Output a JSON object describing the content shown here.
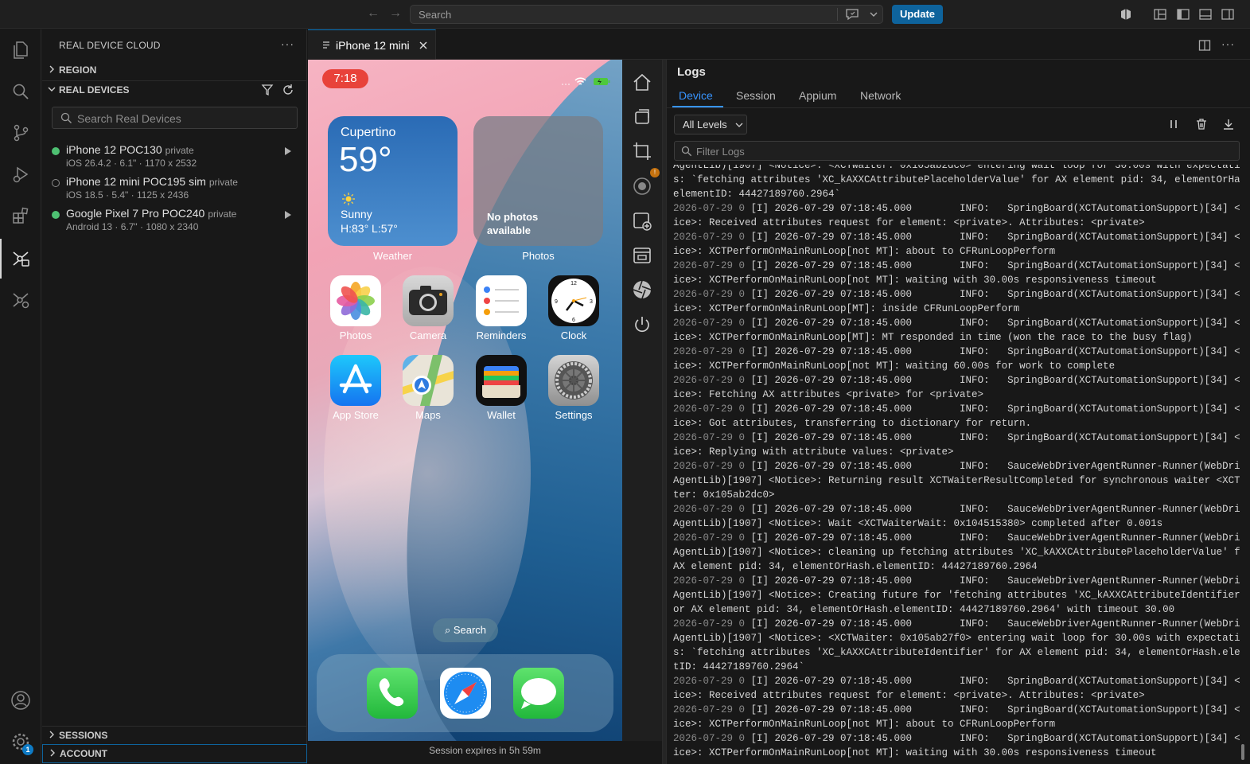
{
  "titlebar": {
    "search_placeholder": "Search",
    "update_label": "Update"
  },
  "sidebar": {
    "title": "REAL DEVICE CLOUD",
    "more": "···",
    "region_label": "REGION",
    "devices_label": "REAL DEVICES",
    "search_placeholder": "Search Real Devices",
    "devices": [
      {
        "name": "iPhone 12 POC130",
        "tag": "private",
        "spec": "iOS 26.4.2 · 6.1\" · 1170 x 2532",
        "status": "online"
      },
      {
        "name": "iPhone 12 mini POC195 sim",
        "tag": "private",
        "spec": "iOS 18.5 · 5.4\" · 1125 x 2436",
        "status": "offline"
      },
      {
        "name": "Google Pixel 7 Pro POC240",
        "tag": "private",
        "spec": "Android 13 · 6.7\" · 1080 x 2340",
        "status": "online"
      }
    ],
    "sessions_label": "SESSIONS",
    "account_label": "ACCOUNT",
    "settings_badge": "1"
  },
  "editor": {
    "tab_label": "iPhone 12 mini",
    "more": "···"
  },
  "phone": {
    "time": "7:18",
    "weather": {
      "city": "Cupertino",
      "temp": "59°",
      "condition": "Sunny",
      "hilo": "H:83° L:57°",
      "label": "Weather"
    },
    "photos_widget": {
      "text": "No photos available",
      "label": "Photos"
    },
    "apps": [
      "Photos",
      "Camera",
      "Reminders",
      "Clock",
      "App Store",
      "Maps",
      "Wallet",
      "Settings"
    ],
    "search_label": "Search",
    "session_expires": "Session expires in 5h 59m"
  },
  "logs": {
    "title": "Logs",
    "tabs": [
      "Device",
      "Session",
      "Appium",
      "Network"
    ],
    "level": "All Levels",
    "filter_placeholder": "Filter Logs",
    "lines": [
      "AgentLib)[1907] <Notice>: <XCTWaiter: 0x105ab2dc0> entering wait loop for 30.00s with expectation",
      "s: `fetching attributes 'XC_kAXXCAttributePlaceholderValue' for AX element pid: 34, elementOrHash.",
      "elementID: 44427189760.2964`",
      "2026-07-29 0 [I] 2026-07-29 07:18:45.000        INFO:   SpringBoard(XCTAutomationSupport)[34] <Not",
      "ice>: Received attributes request for element: <private>. Attributes: <private>",
      "2026-07-29 0 [I] 2026-07-29 07:18:45.000        INFO:   SpringBoard(XCTAutomationSupport)[34] <Not",
      "ice>: XCTPerformOnMainRunLoop[not MT]: about to CFRunLoopPerform",
      "2026-07-29 0 [I] 2026-07-29 07:18:45.000        INFO:   SpringBoard(XCTAutomationSupport)[34] <Not",
      "ice>: XCTPerformOnMainRunLoop[not MT]: waiting with 30.00s responsiveness timeout",
      "2026-07-29 0 [I] 2026-07-29 07:18:45.000        INFO:   SpringBoard(XCTAutomationSupport)[34] <Not",
      "ice>: XCTPerformOnMainRunLoop[MT]: inside CFRunLoopPerform",
      "2026-07-29 0 [I] 2026-07-29 07:18:45.000        INFO:   SpringBoard(XCTAutomationSupport)[34] <Not",
      "ice>: XCTPerformOnMainRunLoop[MT]: MT responded in time (won the race to the busy flag)",
      "2026-07-29 0 [I] 2026-07-29 07:18:45.000        INFO:   SpringBoard(XCTAutomationSupport)[34] <Not",
      "ice>: XCTPerformOnMainRunLoop[not MT]: waiting 60.00s for work to complete",
      "2026-07-29 0 [I] 2026-07-29 07:18:45.000        INFO:   SpringBoard(XCTAutomationSupport)[34] <Not",
      "ice>: Fetching AX attributes <private> for <private>",
      "2026-07-29 0 [I] 2026-07-29 07:18:45.000        INFO:   SpringBoard(XCTAutomationSupport)[34] <Not",
      "ice>: Got attributes, transferring to dictionary for return.",
      "2026-07-29 0 [I] 2026-07-29 07:18:45.000        INFO:   SpringBoard(XCTAutomationSupport)[34] <Not",
      "ice>: Replying with attribute values: <private>",
      "2026-07-29 0 [I] 2026-07-29 07:18:45.000        INFO:   SauceWebDriverAgentRunner-Runner(WebDriver",
      "AgentLib)[1907] <Notice>: Returning result XCTWaiterResultCompleted for synchronous waiter <XCTWai",
      "ter: 0x105ab2dc0>",
      "2026-07-29 0 [I] 2026-07-29 07:18:45.000        INFO:   SauceWebDriverAgentRunner-Runner(WebDriver",
      "AgentLib)[1907] <Notice>: Wait <XCTWaiterWait: 0x104515380> completed after 0.001s",
      "2026-07-29 0 [I] 2026-07-29 07:18:45.000        INFO:   SauceWebDriverAgentRunner-Runner(WebDriver",
      "AgentLib)[1907] <Notice>: cleaning up fetching attributes 'XC_kAXXCAttributePlaceholderValue' for",
      "AX element pid: 34, elementOrHash.elementID: 44427189760.2964",
      "2026-07-29 0 [I] 2026-07-29 07:18:45.000        INFO:   SauceWebDriverAgentRunner-Runner(WebDriver",
      "AgentLib)[1907] <Notice>: Creating future for 'fetching attributes 'XC_kAXXCAttributeIdentifier' f",
      "or AX element pid: 34, elementOrHash.elementID: 44427189760.2964' with timeout 30.00",
      "2026-07-29 0 [I] 2026-07-29 07:18:45.000        INFO:   SauceWebDriverAgentRunner-Runner(WebDriver",
      "AgentLib)[1907] <Notice>: <XCTWaiter: 0x105ab27f0> entering wait loop for 30.00s with expectation",
      "s: `fetching attributes 'XC_kAXXCAttributeIdentifier' for AX element pid: 34, elementOrHash.elemen",
      "tID: 44427189760.2964`",
      "2026-07-29 0 [I] 2026-07-29 07:18:45.000        INFO:   SpringBoard(XCTAutomationSupport)[34] <Not",
      "ice>: Received attributes request for element: <private>. Attributes: <private>",
      "2026-07-29 0 [I] 2026-07-29 07:18:45.000        INFO:   SpringBoard(XCTAutomationSupport)[34] <Not",
      "ice>: XCTPerformOnMainRunLoop[not MT]: about to CFRunLoopPerform",
      "2026-07-29 0 [I] 2026-07-29 07:18:45.000        INFO:   SpringBoard(XCTAutomationSupport)[34] <Not",
      "ice>: XCTPerformOnMainRunLoop[not MT]: waiting with 30.00s responsiveness timeout"
    ]
  },
  "colors": {
    "accent": "#0e639c",
    "active_tab": "#3794ff",
    "online": "#4ec072",
    "time_pill": "#e8423a"
  }
}
